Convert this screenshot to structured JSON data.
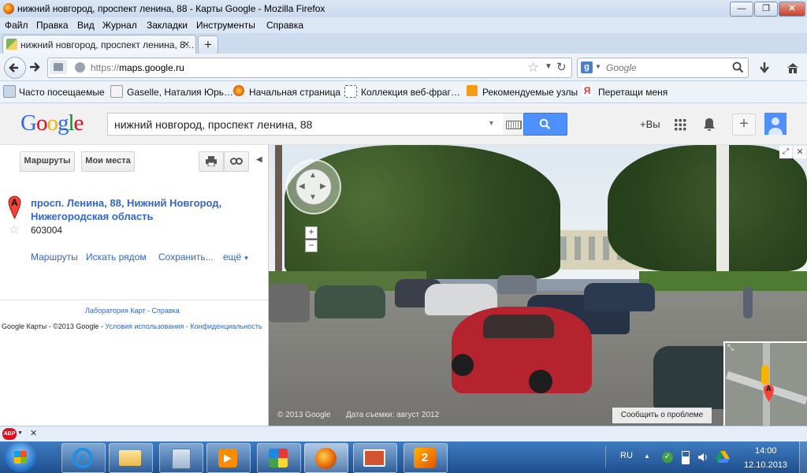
{
  "window": {
    "title": "нижний новгород, проспект ленина, 88 - Карты Google - Mozilla Firefox",
    "min": "—",
    "max": "❐",
    "close": "✕"
  },
  "menu": [
    "Файл",
    "Правка",
    "Вид",
    "Журнал",
    "Закладки",
    "Инструменты",
    "Справка"
  ],
  "tab": {
    "label": "нижний новгород, проспект ленина, 8…",
    "close": "✕",
    "new": "+"
  },
  "nav": {
    "url_prefix": "https://",
    "url_host": "maps.google.ru",
    "search_placeholder": "Google"
  },
  "bookmarks": [
    "Часто посещаемые",
    "Gaselle, Наталия Юрь…",
    "Начальная страница",
    "Коллекция веб-фраг…",
    "Рекомендуемые узлы",
    "Перетащи меня"
  ],
  "google": {
    "logo": [
      "G",
      "o",
      "o",
      "g",
      "l",
      "e"
    ],
    "logo_colors": [
      "#3369e8",
      "#d50f25",
      "#eeb211",
      "#3369e8",
      "#009925",
      "#d50f25"
    ],
    "query": "нижний новгород, проспект ленина, 88",
    "plus_you": "+Вы"
  },
  "panel": {
    "btn_routes": "Маршруты",
    "btn_places": "Мои места",
    "marker": "A",
    "address_line1": "просп. Ленина, 88, Нижний Новгород,",
    "address_line2": "Нижегородская область",
    "postcode": "603004",
    "link_routes": "Маршруты",
    "link_search_near": "Искать рядом",
    "link_save": "Сохранить...",
    "link_more": "ещё",
    "footer_lab": "Лаборатория Карт",
    "footer_sep": " - ",
    "footer_help": "Справка",
    "copyright": "Google Карты - ©2013 Google - ",
    "terms": "Условия использования",
    "privacy": "Конфиденциальность"
  },
  "streetview": {
    "copyright": "© 2013 Google",
    "date": "Дата съемки: август 2012",
    "report": "Сообщить о проблеме",
    "zoom_in": "+",
    "zoom_out": "−",
    "mini_marker": "A"
  },
  "taskbar": {
    "lang": "RU",
    "time": "14:00",
    "date": "12.10.2013"
  },
  "colors": {
    "accent": "#4d90fe",
    "link": "#3366cc",
    "taskbar": "#1f4f8e"
  }
}
